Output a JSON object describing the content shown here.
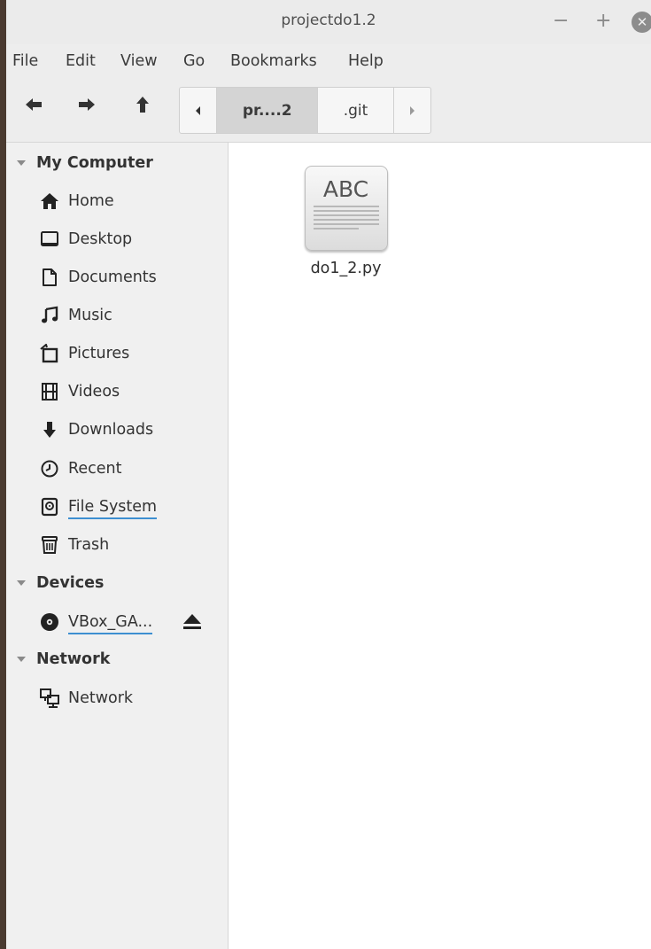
{
  "window": {
    "title": "projectdo1.2"
  },
  "menubar": [
    "File",
    "Edit",
    "View",
    "Go",
    "Bookmarks",
    "Help"
  ],
  "pathbar": {
    "segments": [
      "pr....2",
      ".git"
    ]
  },
  "sidebar": {
    "sections": [
      {
        "title": "My Computer",
        "items": [
          {
            "label": "Home",
            "icon": "home-icon"
          },
          {
            "label": "Desktop",
            "icon": "desktop-icon"
          },
          {
            "label": "Documents",
            "icon": "documents-icon"
          },
          {
            "label": "Music",
            "icon": "music-icon"
          },
          {
            "label": "Pictures",
            "icon": "pictures-icon"
          },
          {
            "label": "Videos",
            "icon": "videos-icon"
          },
          {
            "label": "Downloads",
            "icon": "downloads-icon"
          },
          {
            "label": "Recent",
            "icon": "recent-icon"
          },
          {
            "label": "File System",
            "icon": "filesystem-icon"
          },
          {
            "label": "Trash",
            "icon": "trash-icon"
          }
        ]
      },
      {
        "title": "Devices",
        "items": [
          {
            "label": "VBox_GA...",
            "icon": "disc-icon"
          }
        ]
      },
      {
        "title": "Network",
        "items": [
          {
            "label": "Network",
            "icon": "network-icon"
          }
        ]
      }
    ]
  },
  "files": [
    {
      "name": "do1_2.py",
      "icon_text": "ABC",
      "icon": "text-file-icon"
    }
  ],
  "colors": {
    "accent": "#3d8fd1",
    "window_bg": "#ededed",
    "content_bg": "#ffffff"
  }
}
